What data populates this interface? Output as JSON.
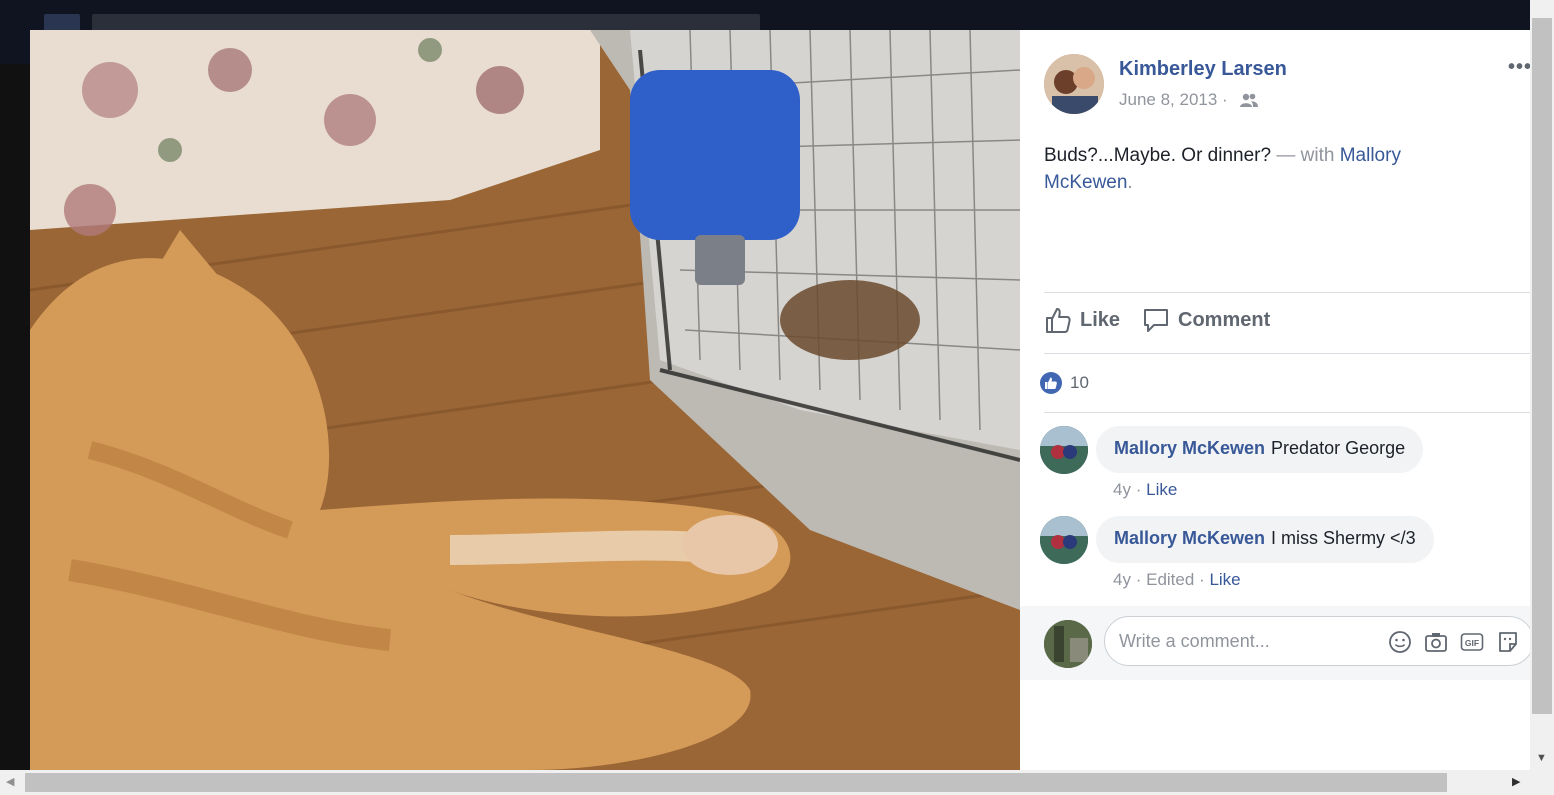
{
  "post": {
    "author": "Kimberley Larsen",
    "date": "June 8, 2013",
    "separator": "·",
    "audience_icon": "friends-icon",
    "more_label": "•••",
    "text": "Buds?...Maybe. Or dinner?",
    "with_label": "— with",
    "tagged": "Mallory McKewen",
    "tagged_suffix": "."
  },
  "actions": {
    "like_label": "Like",
    "comment_label": "Comment"
  },
  "reactions": {
    "count": "10"
  },
  "comments": [
    {
      "author": "Mallory McKewen",
      "text": "Predator George",
      "time": "4y",
      "dot": "·",
      "edited": "",
      "like": "Like"
    },
    {
      "author": "Mallory McKewen",
      "text": "I miss Shermy </3",
      "time": "4y",
      "dot": "·",
      "edited": "Edited",
      "like": "Like"
    }
  ],
  "composer": {
    "placeholder": "Write a comment...",
    "icons": [
      "emoji-icon",
      "camera-icon",
      "gif-icon",
      "sticker-icon"
    ],
    "gif_label": "GIF"
  },
  "colors": {
    "link": "#385898",
    "like_blue": "#4267b2",
    "meta_gray": "#90949c"
  }
}
